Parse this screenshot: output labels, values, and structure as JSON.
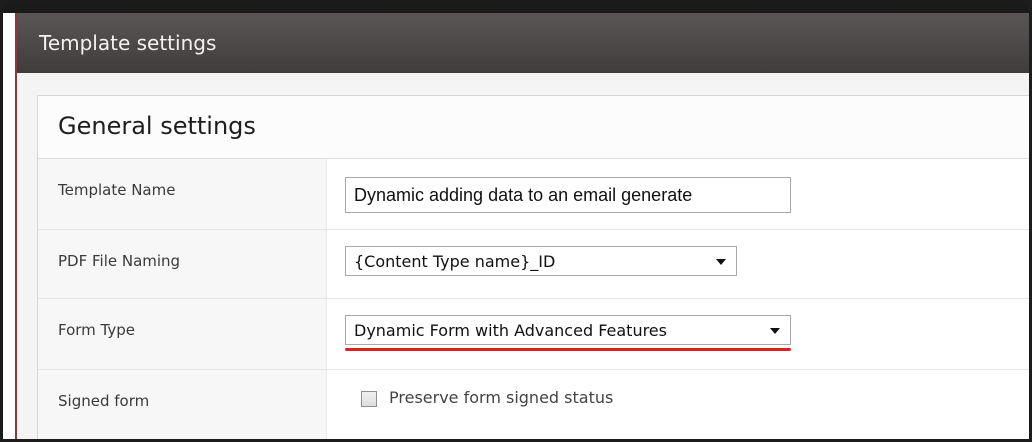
{
  "dialog": {
    "title": "Template settings"
  },
  "section": {
    "title": "General settings"
  },
  "fields": {
    "template_name": {
      "label": "Template Name",
      "value": "Dynamic adding data to an email generate"
    },
    "pdf_file_naming": {
      "label": "PDF File Naming",
      "selected": "{Content Type name}_ID"
    },
    "form_type": {
      "label": "Form Type",
      "selected": "Dynamic Form with Advanced Features"
    },
    "signed_form": {
      "label": "Signed form",
      "checkbox_label": "Preserve form signed status",
      "checked": false
    }
  },
  "colors": {
    "titlebar": "#4e4a49",
    "highlight_underline": "#e02020"
  }
}
